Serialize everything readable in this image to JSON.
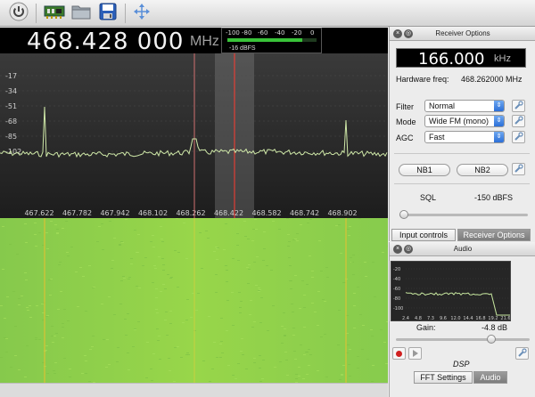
{
  "toolbar": {
    "buttons": [
      {
        "name": "power-icon"
      },
      {
        "name": "hardware-icon"
      },
      {
        "name": "folder-icon"
      },
      {
        "name": "save-icon"
      },
      {
        "name": "move-icon"
      }
    ]
  },
  "frequency": {
    "digits": "468.428 000",
    "unit": "MHz"
  },
  "signal_meter": {
    "ticks": [
      "-100",
      "-80",
      "-60",
      "-40",
      "-20",
      "0"
    ],
    "level_fraction": 0.84,
    "value_text": "-16 dBFS"
  },
  "spectrum": {
    "y_ticks": [
      "-17",
      "-34",
      "-51",
      "-68",
      "-85",
      "-102"
    ],
    "x_ticks": [
      "467.622",
      "467.782",
      "467.942",
      "468.102",
      "468.262",
      "468.422",
      "468.582",
      "468.742",
      "468.902"
    ],
    "colors": {
      "trace": "#cfe8a8",
      "tuned_line": "#ff3b30",
      "center_line": "#d07070",
      "grid": "#555555"
    }
  },
  "waterfall": {
    "colors": {
      "background": "#8fd24a",
      "signal_line": "#f0c020"
    }
  },
  "receiver_options": {
    "title": "Receiver Options",
    "offset_value": "166.000",
    "offset_unit": "kHz",
    "hardware_freq_label": "Hardware freq:",
    "hardware_freq_value": "468.262000 MHz",
    "filter_label": "Filter",
    "filter_value": "Normal",
    "mode_label": "Mode",
    "mode_value": "Wide FM (mono)",
    "agc_label": "AGC",
    "agc_value": "Fast",
    "nb1_label": "NB1",
    "nb2_label": "NB2",
    "sql_label": "SQL",
    "sql_value": "-150 dBFS",
    "sql_slider_fraction": 0.0
  },
  "dock_tabs": {
    "input_controls": "Input controls",
    "receiver_options": "Receiver Options"
  },
  "audio": {
    "title": "Audio",
    "y_ticks": [
      "-20",
      "-40",
      "-60",
      "-80",
      "-100"
    ],
    "x_ticks": [
      "2.4",
      "4.8",
      "7.3",
      "9.6",
      "12.0",
      "14.4",
      "16.8",
      "19.2",
      "21.6"
    ],
    "gain_label": "Gain:",
    "gain_value": "-4.8 dB",
    "gain_slider_fraction": 0.73,
    "dsp_label": "DSP"
  },
  "bottom_tabs": {
    "fft_settings": "FFT Settings",
    "audio": "Audio"
  }
}
